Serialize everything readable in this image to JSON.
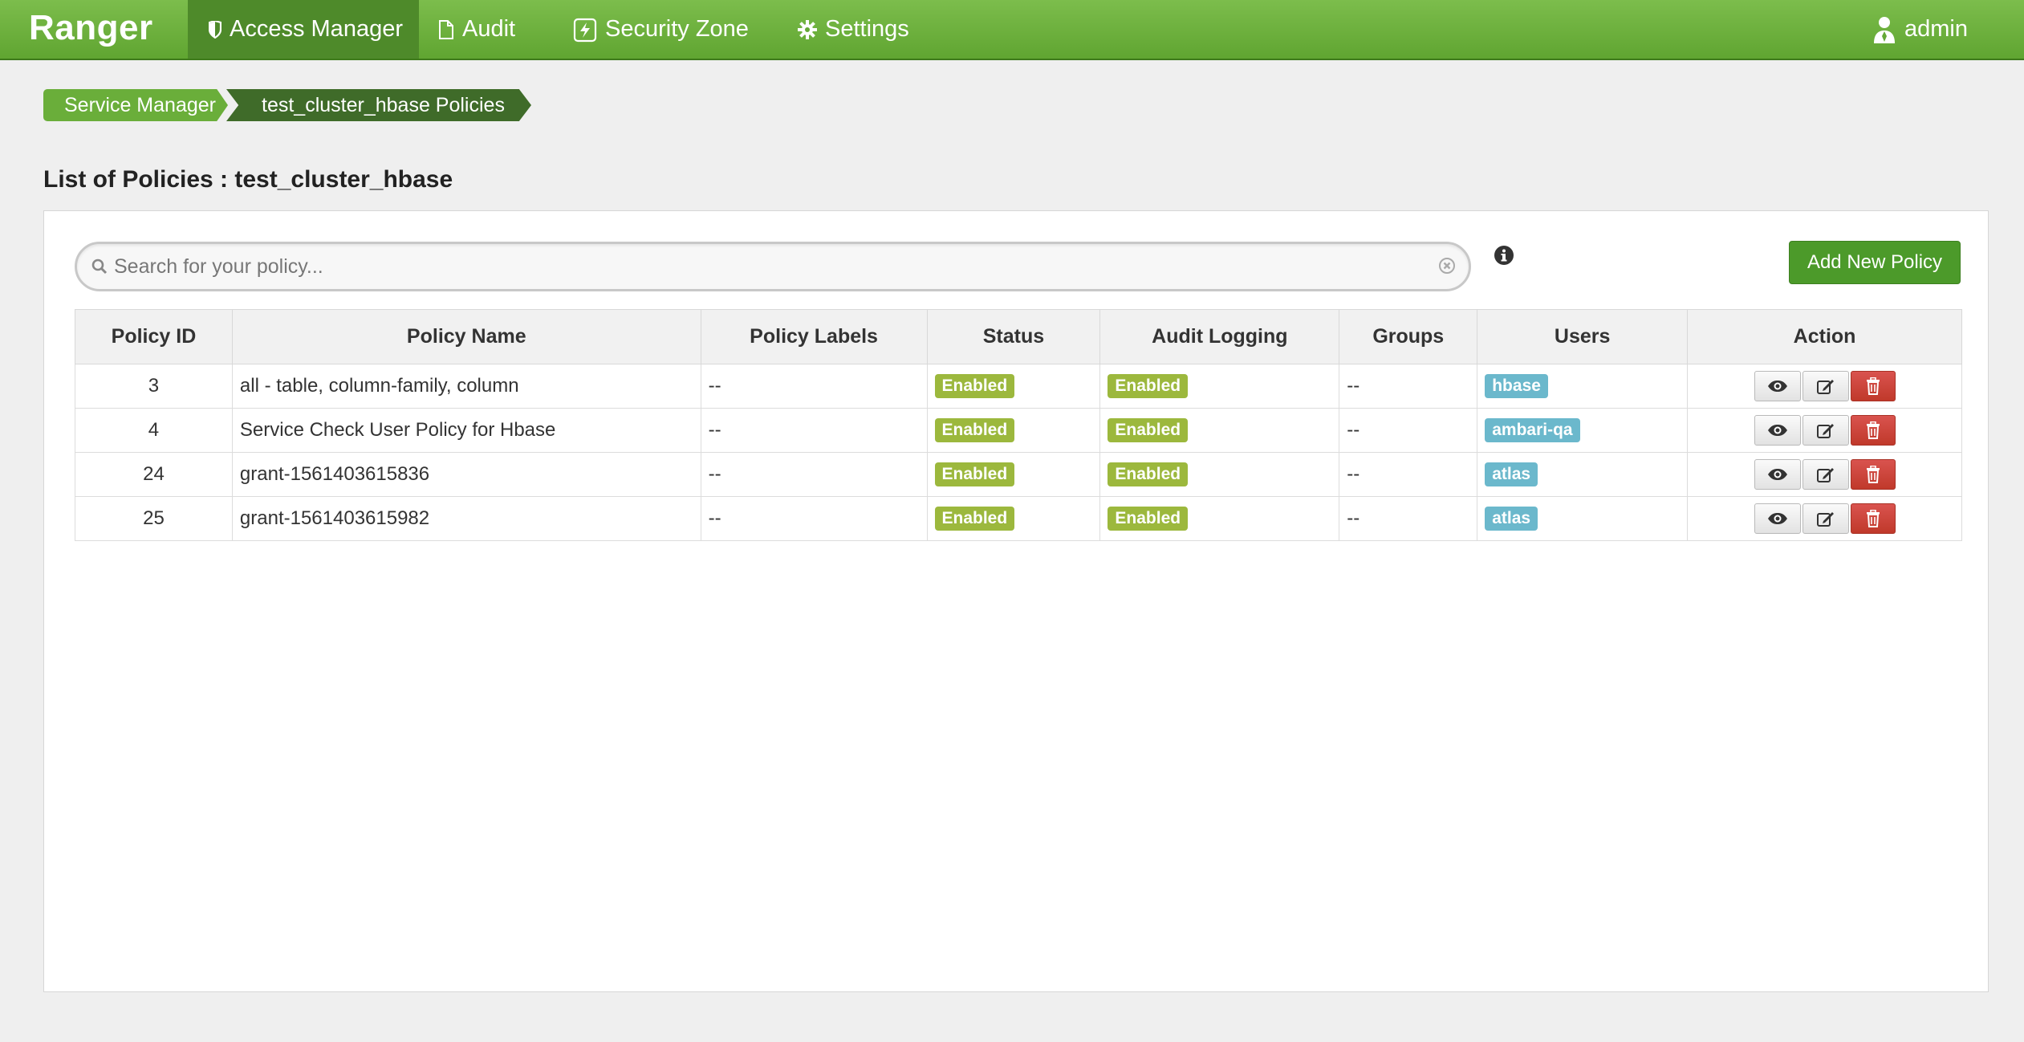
{
  "nav": {
    "brand": "Ranger",
    "items": [
      {
        "label": "Access Manager",
        "icon": "shield-icon",
        "active": true
      },
      {
        "label": "Audit",
        "icon": "file-icon"
      },
      {
        "label": "Security Zone",
        "icon": "lightning-icon"
      },
      {
        "label": "Settings",
        "icon": "gear-icon"
      }
    ],
    "user": "admin"
  },
  "breadcrumb": [
    "Service Manager",
    "test_cluster_hbase Policies"
  ],
  "page_title": "List of Policies : test_cluster_hbase",
  "search": {
    "placeholder": "Search for your policy...",
    "value": ""
  },
  "add_button": "Add New Policy",
  "table": {
    "columns": [
      "Policy ID",
      "Policy Name",
      "Policy Labels",
      "Status",
      "Audit Logging",
      "Groups",
      "Users",
      "Action"
    ],
    "rows": [
      {
        "id": "3",
        "name": "all - table, column-family, column",
        "labels": "--",
        "status": "Enabled",
        "audit": "Enabled",
        "groups": "--",
        "users": "hbase"
      },
      {
        "id": "4",
        "name": "Service Check User Policy for Hbase",
        "labels": "--",
        "status": "Enabled",
        "audit": "Enabled",
        "groups": "--",
        "users": "ambari-qa"
      },
      {
        "id": "24",
        "name": "grant-1561403615836",
        "labels": "--",
        "status": "Enabled",
        "audit": "Enabled",
        "groups": "--",
        "users": "atlas"
      },
      {
        "id": "25",
        "name": "grant-1561403615982",
        "labels": "--",
        "status": "Enabled",
        "audit": "Enabled",
        "groups": "--",
        "users": "atlas"
      }
    ]
  },
  "colors": {
    "nav_green": "#6aae3a",
    "active_green": "#4e8a2a",
    "status_badge": "#9cb83d",
    "user_badge": "#6bb8cc",
    "delete_red": "#d9534f"
  }
}
